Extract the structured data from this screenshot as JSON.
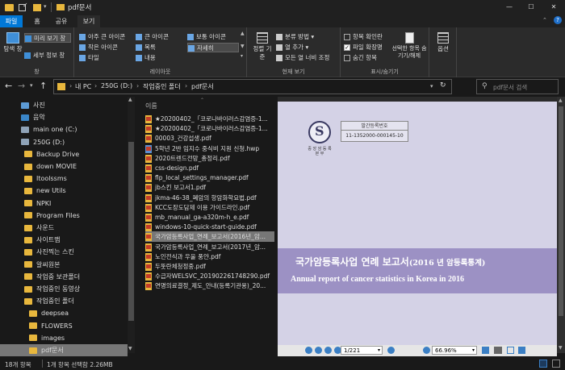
{
  "window": {
    "title": "pdf문서"
  },
  "tabs": [
    {
      "label": "파일"
    },
    {
      "label": "홈"
    },
    {
      "label": "공유"
    },
    {
      "label": "보기"
    }
  ],
  "ribbon": {
    "pane": {
      "nav_pane": "탐색 창",
      "preview_pane": "미리 보기 창",
      "details_pane": "세부 정보 창",
      "label": "창"
    },
    "layout": {
      "items": [
        "아주 큰 아이콘",
        "큰 아이콘",
        "보통 아이콘",
        "작은 아이콘",
        "목록",
        "자세히",
        "타일",
        "내용"
      ],
      "label": "레이아웃"
    },
    "current_view": {
      "sort": "정렬 기준",
      "group_by": "분류 방법",
      "add_columns": "열 추가",
      "fit_columns": "모든 열 너비 조정",
      "label": "현재 보기"
    },
    "show_hide": {
      "item_checkboxes": "항목 확인란",
      "file_extensions": "파일 확장명",
      "hidden_items": "숨긴 항목",
      "hide_selected": "선택한 항목 숨기기/해제",
      "label": "표시/숨기기"
    },
    "options": {
      "label": "옵션"
    }
  },
  "address": {
    "path": [
      "내 PC",
      "250G (D:)",
      "작업중인 폴더",
      "pdf문서"
    ],
    "search_placeholder": "pdf문서 검색"
  },
  "nav": [
    {
      "label": "사진",
      "indent": 0,
      "kind": "photo"
    },
    {
      "label": "음악",
      "indent": 0,
      "kind": "music"
    },
    {
      "label": "main one (C:)",
      "indent": 0,
      "kind": "drive"
    },
    {
      "label": "250G (D:)",
      "indent": 0,
      "kind": "drive"
    },
    {
      "label": "Backup Drive",
      "indent": 1,
      "kind": "folder"
    },
    {
      "label": "down MOVIE",
      "indent": 1,
      "kind": "folder"
    },
    {
      "label": "Itoolssms",
      "indent": 1,
      "kind": "folder"
    },
    {
      "label": "new Utils",
      "indent": 1,
      "kind": "folder"
    },
    {
      "label": "NPKI",
      "indent": 1,
      "kind": "folder"
    },
    {
      "label": "Program Files",
      "indent": 1,
      "kind": "folder"
    },
    {
      "label": "사운드",
      "indent": 1,
      "kind": "folder"
    },
    {
      "label": "사이트맵",
      "indent": 1,
      "kind": "folder"
    },
    {
      "label": "사진찍는 스킨",
      "indent": 1,
      "kind": "folder"
    },
    {
      "label": "알씨원본",
      "indent": 1,
      "kind": "folder"
    },
    {
      "label": "작업중 보관폴더",
      "indent": 1,
      "kind": "folder"
    },
    {
      "label": "작업중인 동영상",
      "indent": 1,
      "kind": "folder"
    },
    {
      "label": "작업중인 폴더",
      "indent": 1,
      "kind": "folder"
    },
    {
      "label": "deepsea",
      "indent": 2,
      "kind": "folder"
    },
    {
      "label": "FLOWERS",
      "indent": 2,
      "kind": "folder"
    },
    {
      "label": "images",
      "indent": 2,
      "kind": "folder"
    },
    {
      "label": "pdf문서",
      "indent": 2,
      "kind": "folder",
      "selected": true
    }
  ],
  "files": {
    "header": "이름",
    "rows": [
      {
        "name": "★20200402_「코로나바이러스감염증-1..."
      },
      {
        "name": "★20200402_「코로나바이러스감염증-1..."
      },
      {
        "name": "00003_건강섭생.pdf"
      },
      {
        "name": "5학년 2반 임지수 중식비 지원 신청.hwp",
        "kind": "hwp"
      },
      {
        "name": "2020트렌드전망_총정리.pdf"
      },
      {
        "name": "css-design.pdf"
      },
      {
        "name": "flp_local_settings_manager.pdf"
      },
      {
        "name": "jb스킨 보고서1.pdf"
      },
      {
        "name": "jkma-46-38_폐암의 항암화학요법.pdf"
      },
      {
        "name": "KCC도장도담제 이용 가이드라인.pdf"
      },
      {
        "name": "mb_manual_ga-a320m-h_e.pdf"
      },
      {
        "name": "windows-10-quick-start-guide.pdf"
      },
      {
        "name": "국가암등록사업_연례_보고서(2016년_암...",
        "selected": true
      },
      {
        "name": "국가암등록사업_연례_보고서(2017년_암..."
      },
      {
        "name": "노인전식과 우울 풍얀.pdf"
      },
      {
        "name": "두뚯란체청정중.pdf"
      },
      {
        "name": "수급자WELSVC_201902261748290.pdf"
      },
      {
        "name": "연명의료결정_제도_안내(등록기관용)_20..."
      }
    ]
  },
  "preview": {
    "reg_label": "발간등록번호",
    "reg_number": "11-1352000-000145-10",
    "emblem_text": "중 앙 암 등 록 본 부",
    "title_ko": "국가암등록사업 연례 보고서",
    "title_ko_sub": "(2016 년 암등록통계)",
    "title_en": "Annual report of cancer statistics in Korea in 2016",
    "page": "1/221",
    "zoom": "66.96%"
  },
  "status": {
    "count": "18개 항목",
    "selection": "1개 항목 선택함 2.26MB"
  },
  "colors": {
    "folder": "#e8b73d",
    "accent": "#0078d7",
    "preview_band": "#9c91c4",
    "preview_page": "#d4d2e6"
  }
}
